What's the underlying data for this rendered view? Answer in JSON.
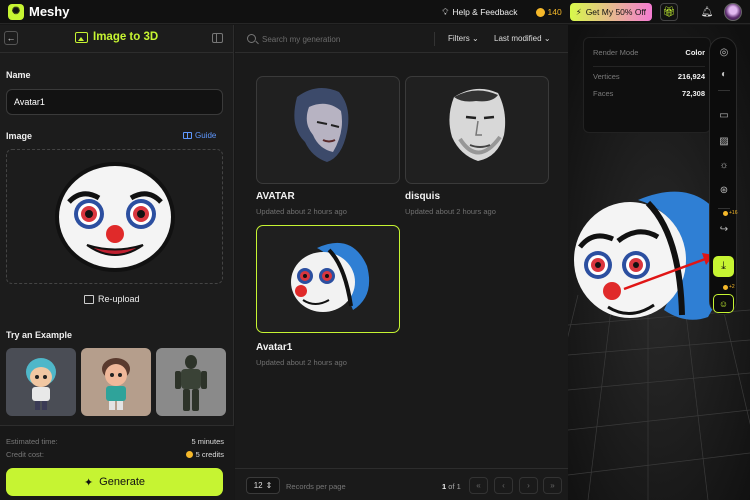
{
  "app": {
    "name": "Meshy",
    "help_label": "Help & Feedback",
    "credits": "140",
    "promo_label": "Get My 50% Off"
  },
  "left_panel": {
    "title": "Image to 3D",
    "name_label": "Name",
    "name_value": "Avatar1",
    "image_label": "Image",
    "guide_label": "Guide",
    "reupload_label": "Re-upload",
    "examples_label": "Try an Example",
    "estimated_time_label": "Estimated time:",
    "estimated_time_value": "5 minutes",
    "credit_cost_label": "Credit cost:",
    "credit_cost_value": "5 credits",
    "generate_label": "Generate"
  },
  "gallery": {
    "search_placeholder": "Search my generation",
    "filters_label": "Filters",
    "sort_label": "Last modified",
    "items": [
      {
        "title": "AVATAR",
        "subtitle": "Updated about 2 hours ago",
        "selected": false
      },
      {
        "title": "disquis",
        "subtitle": "Updated about 2 hours ago",
        "selected": false
      },
      {
        "title": "Avatar1",
        "subtitle": "Updated about 2 hours ago",
        "selected": true
      }
    ],
    "page_size": "12",
    "records_per_page_label": "Records per page",
    "page_current": "1",
    "page_of_label": "of 1"
  },
  "viewer": {
    "render_mode_label": "Render Mode",
    "render_mode_value": "Color",
    "vertices_label": "Vertices",
    "vertices_value": "216,924",
    "faces_label": "Faces",
    "faces_value": "72,308",
    "share_cost": "+16",
    "feedback_cost": "+2"
  },
  "colors": {
    "accent": "#c6f432",
    "link": "#5f98ff",
    "coin": "#f5b82a",
    "annotation_arrow": "#e01515"
  }
}
